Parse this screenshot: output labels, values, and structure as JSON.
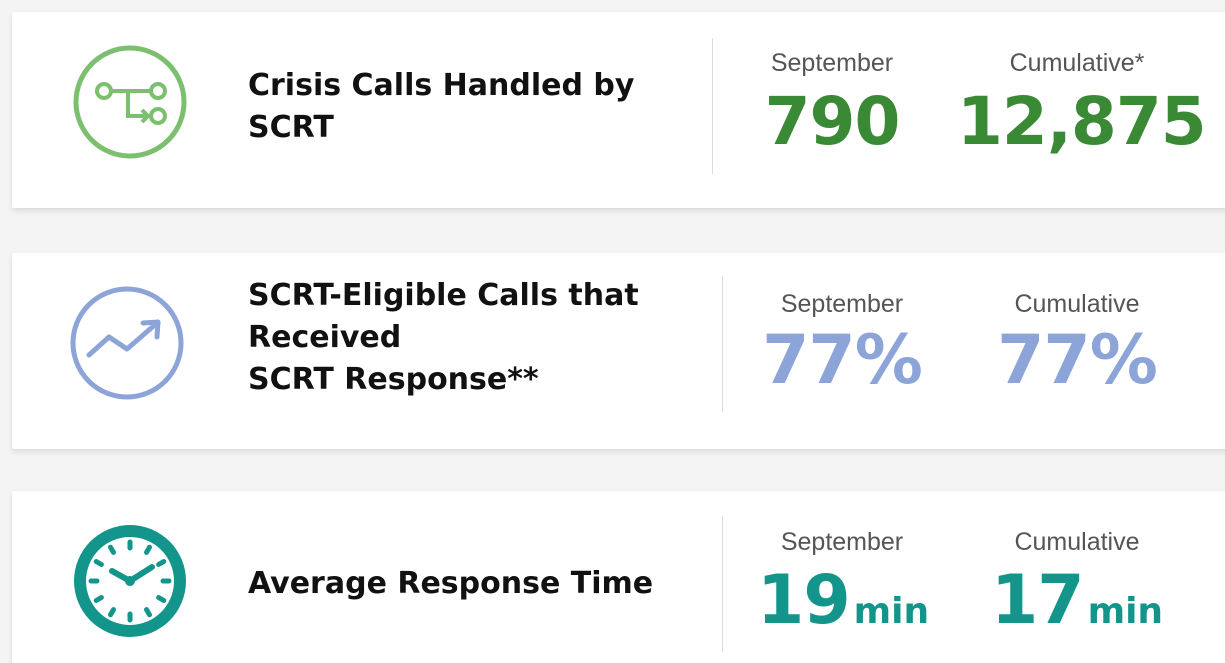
{
  "colors": {
    "green": "#3a8a35",
    "green_icon": "#7bbf6f",
    "blue": "#8da4d8",
    "teal": "#13958b"
  },
  "cards": [
    {
      "icon": "branch-flow-icon",
      "label_lines": [
        "Crisis Calls Handled by",
        "SCRT"
      ],
      "stats": [
        {
          "head": "September",
          "value": "790",
          "unit": ""
        },
        {
          "head": "Cumulative*",
          "value": "12,875",
          "unit": ""
        }
      ]
    },
    {
      "icon": "trend-up-icon",
      "label_lines": [
        "SCRT-Eligible Calls that",
        "Received",
        "SCRT Response**"
      ],
      "stats": [
        {
          "head": "September",
          "value": "77%",
          "unit": ""
        },
        {
          "head": "Cumulative",
          "value": "77%",
          "unit": ""
        }
      ]
    },
    {
      "icon": "clock-icon",
      "label_lines": [
        "Average Response Time"
      ],
      "stats": [
        {
          "head": "September",
          "value": "19",
          "unit": "min"
        },
        {
          "head": "Cumulative",
          "value": "17",
          "unit": "min"
        }
      ]
    }
  ]
}
